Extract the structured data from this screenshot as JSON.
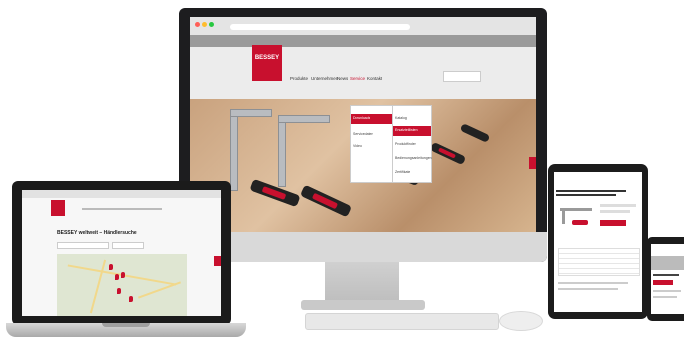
{
  "brand": {
    "name": "BESSEY",
    "accent_color": "#c8102e"
  },
  "monitor": {
    "menu": [
      "Produkte",
      "Unternehmen",
      "News",
      "Service",
      "Kontakt"
    ],
    "dropdown_left": [
      "Downloads",
      "Servicedaten",
      "Video"
    ],
    "dropdown_right": [
      "Katalog",
      "Ersatzteillisten",
      "Produktfinder",
      "Bedienungsanleitungen",
      "Zertifikate"
    ]
  },
  "laptop": {
    "page_title": "BESSEY weltweit – Händlersuche"
  },
  "icons": [
    "search-icon",
    "map-pin-icon",
    "clamp-product-icon"
  ]
}
